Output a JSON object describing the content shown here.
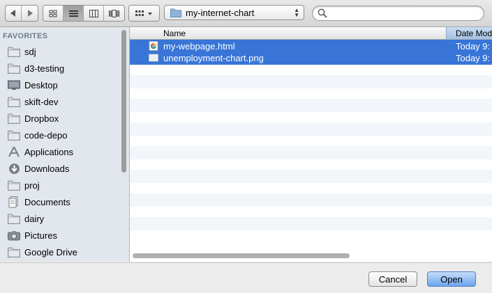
{
  "toolbar": {
    "nav": [
      {
        "icon": "chevron-left-icon"
      },
      {
        "icon": "chevron-right-icon"
      }
    ],
    "view_modes": [
      {
        "icon": "icon-view-icon"
      },
      {
        "icon": "list-view-icon",
        "active": true
      },
      {
        "icon": "column-view-icon"
      },
      {
        "icon": "coverflow-view-icon"
      }
    ],
    "arrange": {
      "icon": "arrange-grid-icon"
    },
    "location": {
      "value": "my-internet-chart",
      "icon": "folder-icon"
    },
    "search": {
      "value": "",
      "placeholder": "",
      "icon": "search-icon"
    }
  },
  "sidebar": {
    "header": "FAVORITES",
    "items": [
      {
        "label": "sdj",
        "icon": "folder-icon"
      },
      {
        "label": "d3-testing",
        "icon": "folder-icon"
      },
      {
        "label": "Desktop",
        "icon": "desktop-icon"
      },
      {
        "label": "skift-dev",
        "icon": "folder-icon"
      },
      {
        "label": "Dropbox",
        "icon": "folder-icon"
      },
      {
        "label": "code-depo",
        "icon": "folder-icon"
      },
      {
        "label": "Applications",
        "icon": "applications-icon"
      },
      {
        "label": "Downloads",
        "icon": "downloads-icon"
      },
      {
        "label": "proj",
        "icon": "folder-icon"
      },
      {
        "label": "Documents",
        "icon": "documents-icon"
      },
      {
        "label": "dairy",
        "icon": "folder-icon"
      },
      {
        "label": "Pictures",
        "icon": "camera-icon"
      },
      {
        "label": "Google Drive",
        "icon": "folder-icon"
      }
    ]
  },
  "file_list": {
    "columns": {
      "name": "Name",
      "date": "Date Mod"
    },
    "files": [
      {
        "name": "my-webpage.html",
        "date": "Today 9:",
        "icon": "html-file-icon",
        "selected": true
      },
      {
        "name": "unemployment-chart.png",
        "date": "Today 9:",
        "icon": "image-file-icon",
        "selected": true
      }
    ]
  },
  "buttons": {
    "cancel": "Cancel",
    "open": "Open"
  },
  "colors": {
    "selection": "#3875d7",
    "sidebar_bg": "#e2e7ed",
    "alt_row": "#f2f5fa"
  }
}
